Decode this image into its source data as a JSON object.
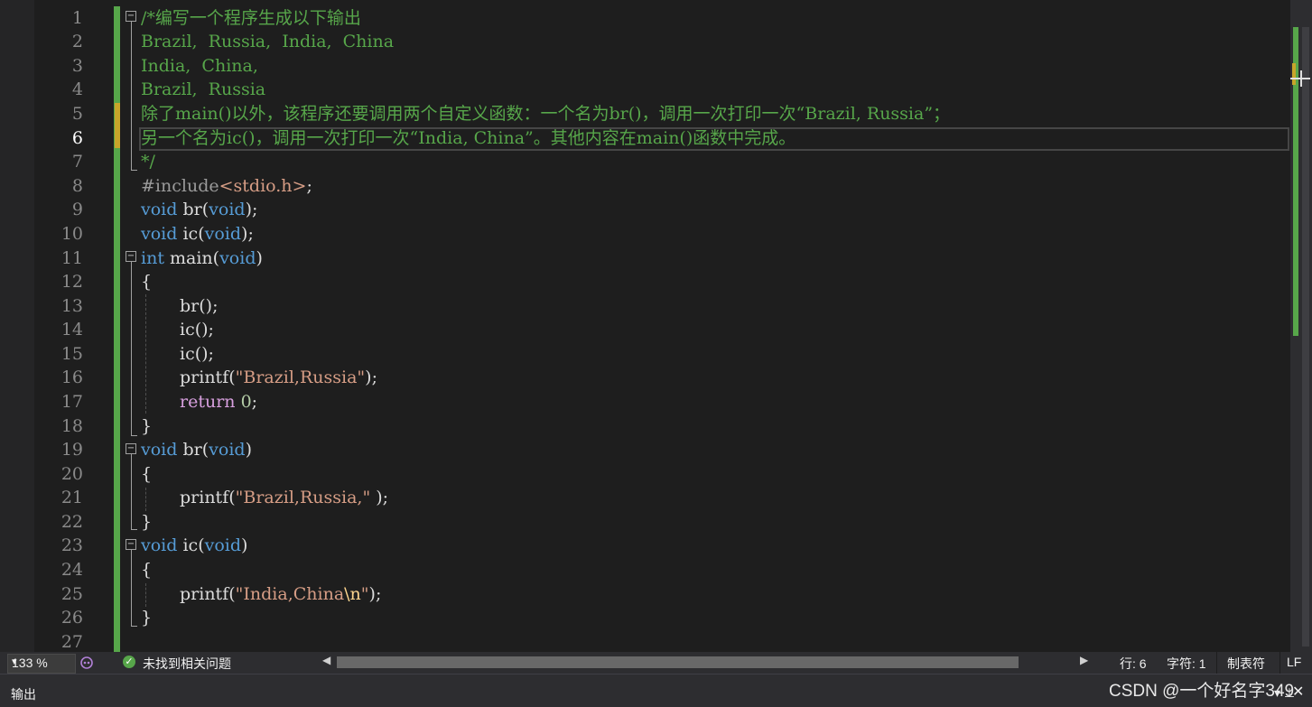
{
  "line_numbers": [
    "1",
    "2",
    "3",
    "4",
    "5",
    "6",
    "7",
    "8",
    "9",
    "10",
    "11",
    "12",
    "13",
    "14",
    "15",
    "16",
    "17",
    "18",
    "19",
    "20",
    "21",
    "22",
    "23",
    "24",
    "25",
    "26",
    "27"
  ],
  "current_line": "6",
  "code": {
    "l1": "/*编写一个程序生成以下输出",
    "l2": "Brazil,  Russia,  India,  China",
    "l3": "India,  China,",
    "l4": "Brazil,  Russia",
    "l5": "除了main()以外，该程序还要调用两个自定义函数：一个名为br()，调用一次打印一次“Brazil, Russia”；",
    "l6": "另一个名为ic()，调用一次打印一次“India, China”。其他内容在main()函数中完成。",
    "l7": "*/",
    "l8_hash": "#include",
    "l8_hdr": "<stdio.h>",
    "l8_semi": ";",
    "kw_void": "void",
    "kw_int": "int",
    "kw_return": "return",
    "fn_br": " br",
    "fn_ic": " ic",
    "fn_main": " main",
    "paren_open": "(",
    "paren_close": ")",
    "proto_end": ");",
    "brace_open": "{",
    "brace_close": "}",
    "call_br": "br",
    "call_ic": "ic",
    "call_tail": "();",
    "printf": "printf(",
    "str_main": "\"Brazil,Russia\"",
    "str_br": "\"Brazil,Russia,\"",
    "str_ic_a": "\"India,China",
    "str_ic_esc": "\\n",
    "str_ic_b": "\"",
    "stmt_end": ");",
    "stmt_end_space": " );",
    "ret_value": " 0",
    "semi": ";"
  },
  "statusbar": {
    "zoom": "133 %",
    "zoom_arrow": "▾",
    "issue_icon": "✓",
    "issues": "未找到相关问题",
    "scroll_left": "◀",
    "scroll_right": "▶",
    "line": "行: 6",
    "char": "字符: 1",
    "tabs": "制表符",
    "eol": "LF"
  },
  "output_panel": {
    "title": "输出",
    "pin": "▾ ⊥",
    "close": "✕"
  },
  "watermark": "CSDN @一个好名字349",
  "colors": {
    "background": "#1e1e1e",
    "comment": "#57a64a",
    "keyword": "#569cd6",
    "control_keyword": "#d8a0df",
    "string": "#d69d85",
    "text": "#dcdcdc",
    "change_bar": "#57a64a",
    "unsaved_mark": "#c8a52a"
  },
  "icons": [
    "fold-minus-icon",
    "success-check-icon",
    "copilot-icon",
    "scroll-left-icon",
    "scroll-right-icon",
    "pin-icon",
    "close-icon"
  ]
}
